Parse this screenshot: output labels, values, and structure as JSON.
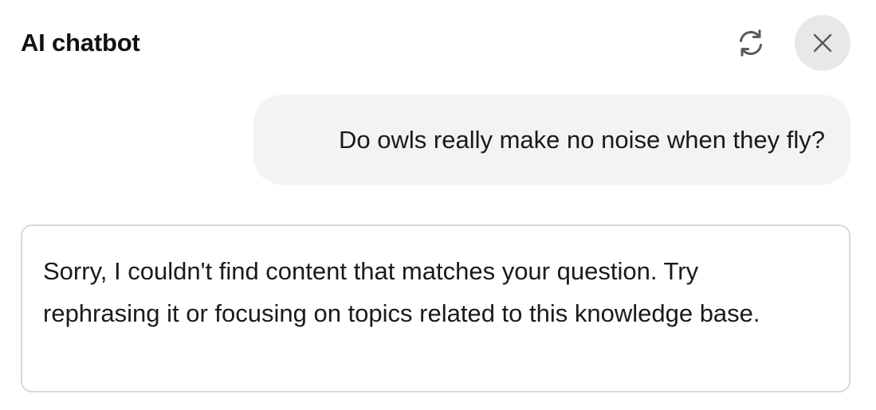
{
  "header": {
    "title": "AI chatbot",
    "refresh_icon": "refresh-icon",
    "close_icon": "close-icon"
  },
  "conversation": {
    "user_message": "Do owls really make no noise when they fly?",
    "bot_message": "Sorry, I couldn't find content that matches your question. Try rephrasing it or focusing on topics related to this knowledge base."
  },
  "colors": {
    "background": "#ffffff",
    "user_bubble": "#f3f3f3",
    "close_button_bg": "#e8e8e8",
    "bot_border": "#d9d9d9",
    "icon": "#5a5a5a",
    "text": "#1a1a1a"
  }
}
